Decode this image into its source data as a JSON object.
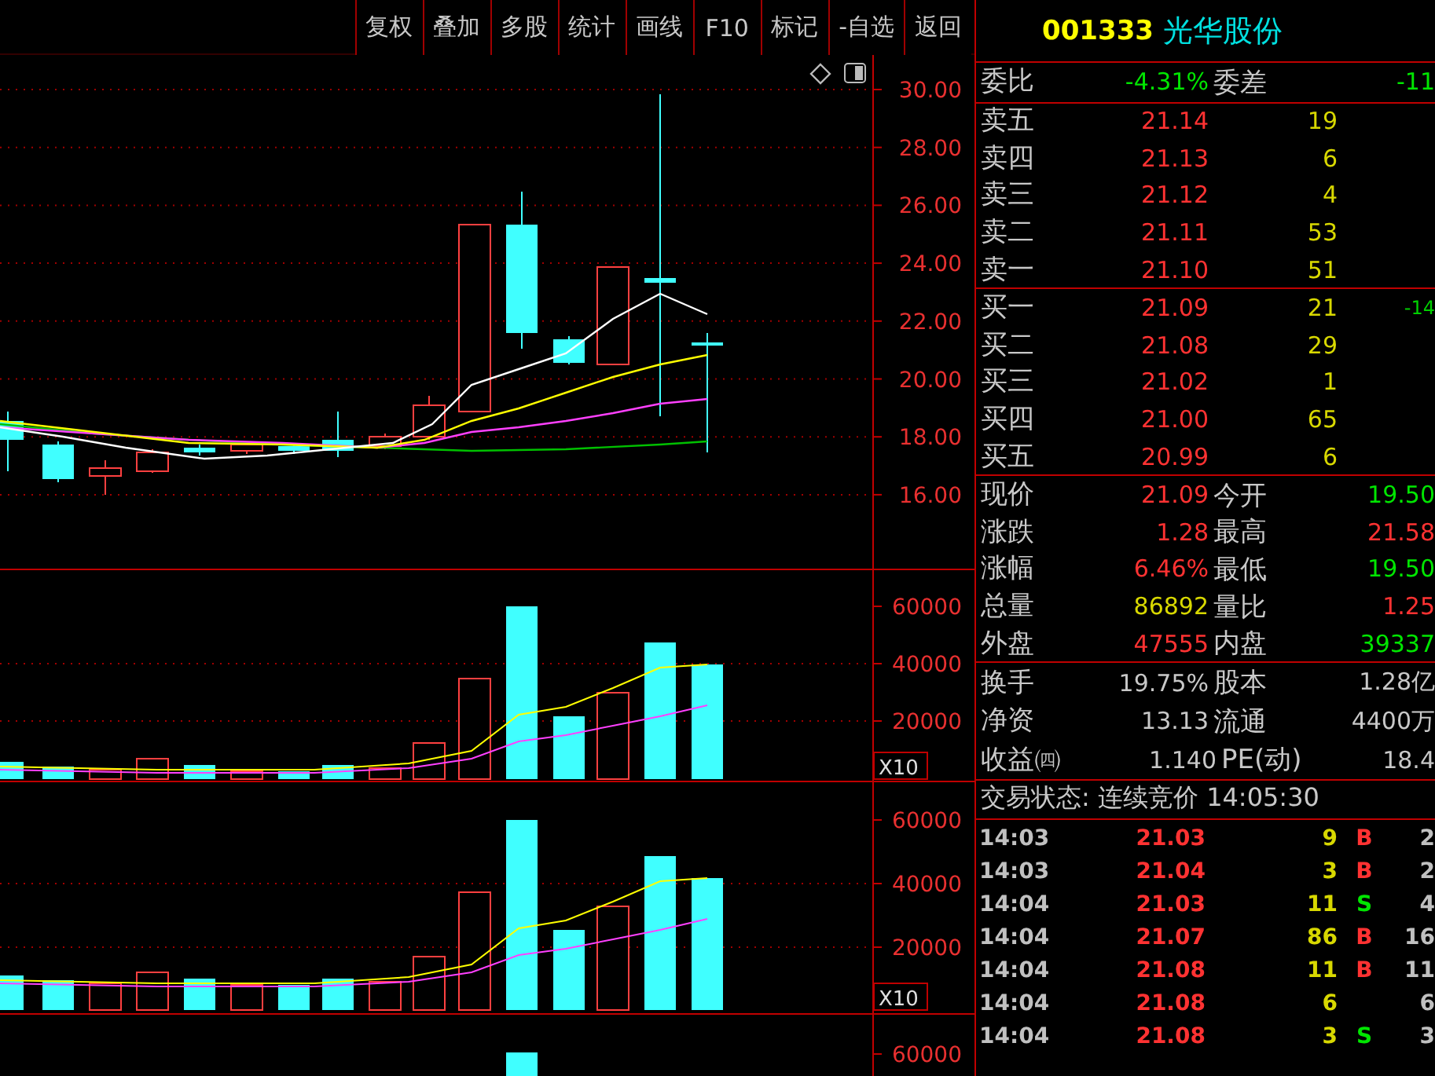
{
  "toolbar": {
    "buttons": [
      "复权",
      "叠加",
      "多股",
      "统计",
      "画线",
      "F10",
      "标记",
      "-自选",
      "返回"
    ]
  },
  "stock": {
    "code": "001333",
    "name": "光华股份"
  },
  "chart": {
    "price_ticks": [
      "30.00",
      "28.00",
      "26.00",
      "24.00",
      "22.00",
      "20.00",
      "18.00",
      "16.00"
    ],
    "volume_panels": [
      {
        "ticks": [
          "60000",
          "40000",
          "20000"
        ],
        "multiplier": "X10"
      },
      {
        "ticks": [
          "60000",
          "40000",
          "20000"
        ],
        "multiplier": "X10"
      },
      {
        "ticks": [
          "60000"
        ]
      }
    ]
  },
  "order_ratio": [
    {
      "label": "委比",
      "value": "-4.31%",
      "color": "#00e600"
    },
    {
      "label": "委差",
      "value": "-11",
      "color": "#00e600"
    }
  ],
  "asks": [
    {
      "label": "卖五",
      "price": "21.14",
      "volume": "19"
    },
    {
      "label": "卖四",
      "price": "21.13",
      "volume": "6"
    },
    {
      "label": "卖三",
      "price": "21.12",
      "volume": "4"
    },
    {
      "label": "卖二",
      "price": "21.11",
      "volume": "53"
    },
    {
      "label": "卖一",
      "price": "21.10",
      "volume": "51"
    }
  ],
  "bids": [
    {
      "label": "买一",
      "price": "21.09",
      "volume": "21",
      "change": "-14"
    },
    {
      "label": "买二",
      "price": "21.08",
      "volume": "29"
    },
    {
      "label": "买三",
      "price": "21.02",
      "volume": "1"
    },
    {
      "label": "买四",
      "price": "21.00",
      "volume": "65"
    },
    {
      "label": "买五",
      "price": "20.99",
      "volume": "6"
    }
  ],
  "quote": [
    [
      {
        "label": "现价",
        "value": "21.09",
        "color": "#ff3232"
      },
      {
        "label": "今开",
        "value": "19.50",
        "color": "#00e600"
      }
    ],
    [
      {
        "label": "涨跌",
        "value": "1.28",
        "color": "#ff3232"
      },
      {
        "label": "最高",
        "value": "21.58",
        "color": "#ff3232"
      }
    ],
    [
      {
        "label": "涨幅",
        "value": "6.46%",
        "color": "#ff3232"
      },
      {
        "label": "最低",
        "value": "19.50",
        "color": "#00e600"
      }
    ],
    [
      {
        "label": "总量",
        "value": "86892",
        "color": "#d8d800"
      },
      {
        "label": "量比",
        "value": "1.25",
        "color": "#ff3232"
      }
    ],
    [
      {
        "label": "外盘",
        "value": "47555",
        "color": "#ff3232"
      },
      {
        "label": "内盘",
        "value": "39337",
        "color": "#00e600"
      }
    ]
  ],
  "fundamentals": [
    {
      "label": "换手",
      "value": "19.75%",
      "label2": "股本",
      "value2": "1.28亿"
    },
    {
      "label": "净资",
      "value": "13.13",
      "label2": "流通",
      "value2": "4400万"
    },
    {
      "label": "收益㈣",
      "value": "1.140",
      "label2": "PE(动)",
      "value2": "18.4"
    }
  ],
  "status": "交易状态: 连续竞价 14:05:30",
  "ticks": [
    {
      "time": "14:03",
      "price": "21.03",
      "volume": "9",
      "side": {
        "text": "B",
        "color": "#ff3232"
      },
      "count": "2"
    },
    {
      "time": "14:03",
      "price": "21.04",
      "volume": "3",
      "side": {
        "text": "B",
        "color": "#ff3232"
      },
      "count": "2"
    },
    {
      "time": "14:04",
      "price": "21.03",
      "volume": "11",
      "side": {
        "text": "S",
        "color": "#00e600"
      },
      "count": "4"
    },
    {
      "time": "14:04",
      "price": "21.07",
      "volume": "86",
      "side": {
        "text": "B",
        "color": "#ff3232"
      },
      "count": "16"
    },
    {
      "time": "14:04",
      "price": "21.08",
      "volume": "11",
      "side": {
        "text": "B",
        "color": "#ff3232"
      },
      "count": "11"
    },
    {
      "time": "14:04",
      "price": "21.08",
      "volume": "6",
      "count": "6"
    },
    {
      "time": "14:04",
      "price": "21.08",
      "volume": "3",
      "side": {
        "text": "S",
        "color": "#00e600"
      },
      "count": "3"
    }
  ]
}
